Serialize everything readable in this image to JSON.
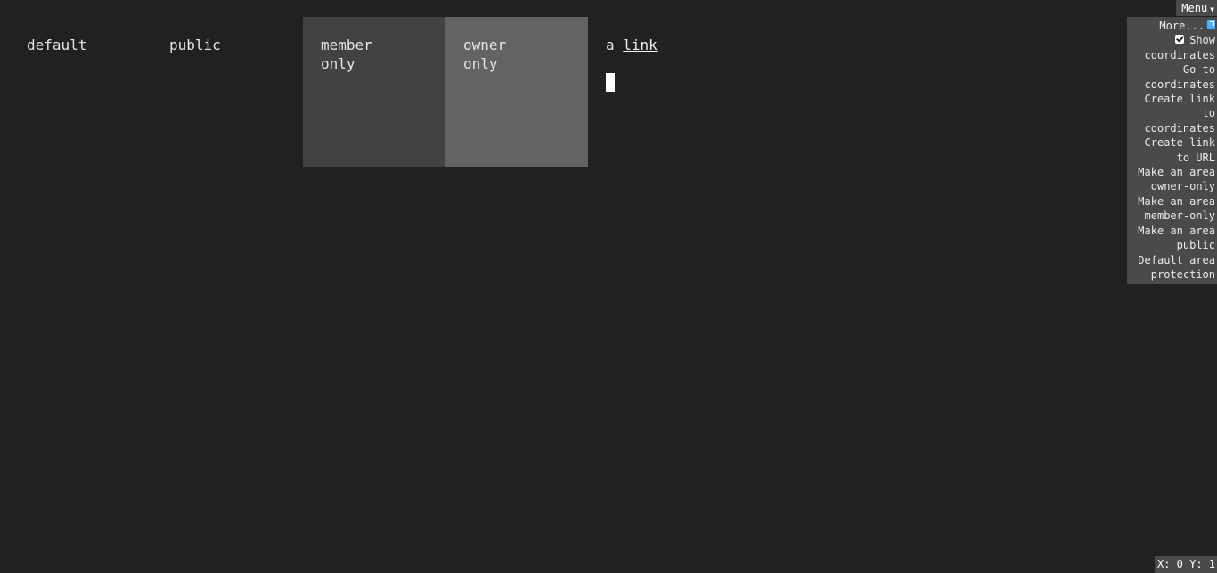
{
  "cells": {
    "default": "default",
    "public": "public",
    "member": "member only",
    "owner": "owner only",
    "link_prefix": "a ",
    "link": "link"
  },
  "menu": {
    "toggle_label": "Menu",
    "more_label": "More...",
    "show_coordinates_label": "Show coordinates",
    "show_coordinates_checked": true,
    "items": [
      "Go to coordinates",
      "Create link to coordinates",
      "Create link to URL",
      "Make an area owner-only",
      "Make an area member-only",
      "Make an area public",
      "Default area protection"
    ]
  },
  "coordinates": {
    "text": "X: 0 Y: 1"
  },
  "colors": {
    "background": "#212121",
    "member_area": "#424242",
    "owner_area": "#636363",
    "menu_bg": "#4a4a4a"
  }
}
